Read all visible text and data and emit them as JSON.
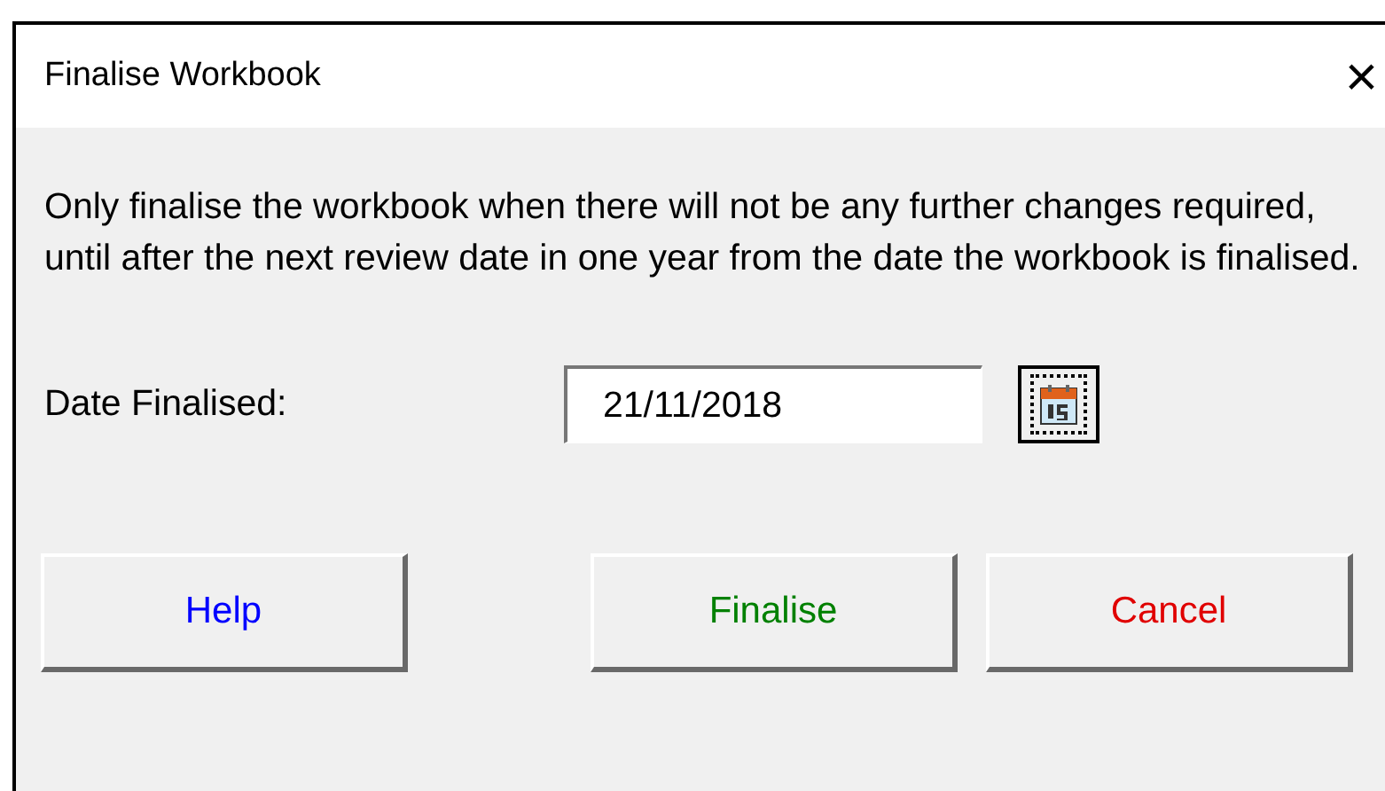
{
  "window": {
    "title": "Finalise Workbook",
    "close": "×"
  },
  "message": "Only finalise the workbook when there will not be any further changes required, until after the next review date in one year from the date the workbook is finalised.",
  "date_field": {
    "label": "Date Finalised:",
    "value": "21/11/2018"
  },
  "buttons": [
    {
      "label": "Help",
      "color": "#0000ff"
    },
    {
      "label": "Finalise",
      "color": "#008000"
    },
    {
      "label": "Cancel",
      "color": "#e00000"
    }
  ]
}
